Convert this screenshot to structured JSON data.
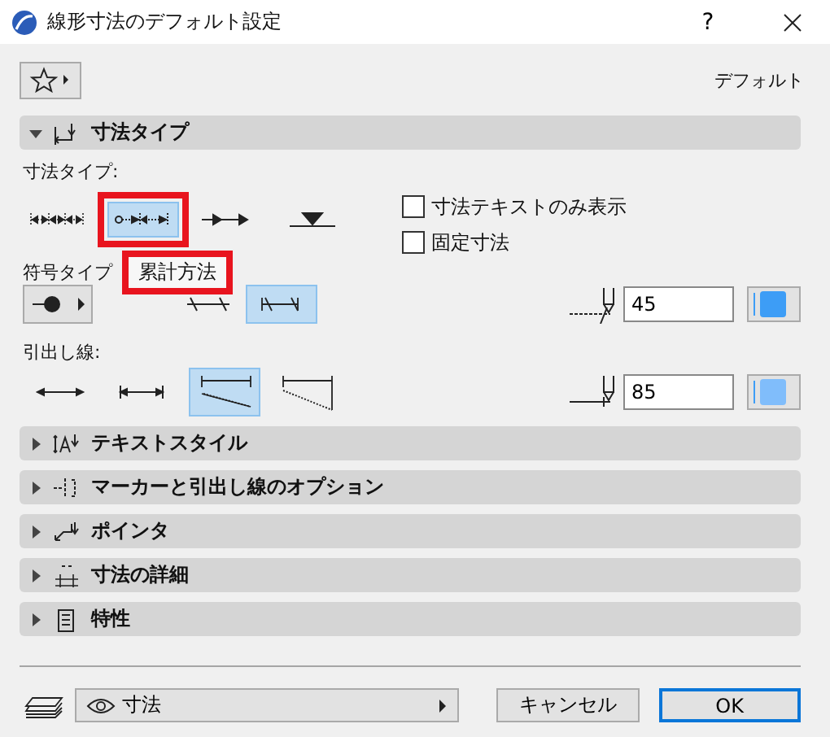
{
  "window": {
    "title": "線形寸法のデフォルト設定",
    "help": "?"
  },
  "preset": {
    "label": "デフォルト"
  },
  "sections": [
    {
      "title": "寸法タイプ",
      "expanded": true
    },
    {
      "title": "テキストスタイル",
      "expanded": false
    },
    {
      "title": "マーカーと引出し線のオプション",
      "expanded": false
    },
    {
      "title": "ポインタ",
      "expanded": false
    },
    {
      "title": "寸法の詳細",
      "expanded": false
    },
    {
      "title": "特性",
      "expanded": false
    }
  ],
  "dimension_type": {
    "label": "寸法タイプ:",
    "options": [
      {
        "selected": false,
        "highlighted": false
      },
      {
        "selected": true,
        "highlighted": true
      },
      {
        "selected": false,
        "highlighted": false
      },
      {
        "selected": false,
        "highlighted": false
      }
    ],
    "tooltip": {
      "text": "累計方法",
      "highlighted": true
    },
    "checkboxes": [
      {
        "label": "寸法テキストのみ表示",
        "checked": false
      },
      {
        "label": "固定寸法",
        "checked": false
      }
    ]
  },
  "marker_type": {
    "label": "符号タイプ",
    "options": [
      {
        "selected": false
      },
      {
        "selected": true
      }
    ],
    "size": "45",
    "color": "#3d9df6"
  },
  "witness_lines": {
    "label": "引出し線:",
    "options": [
      {
        "selected": false
      },
      {
        "selected": false
      },
      {
        "selected": true
      },
      {
        "selected": false
      }
    ],
    "size": "85",
    "color": "#80bdfb"
  },
  "footer": {
    "layer": "寸法",
    "cancel": "キャンセル",
    "ok": "OK"
  }
}
